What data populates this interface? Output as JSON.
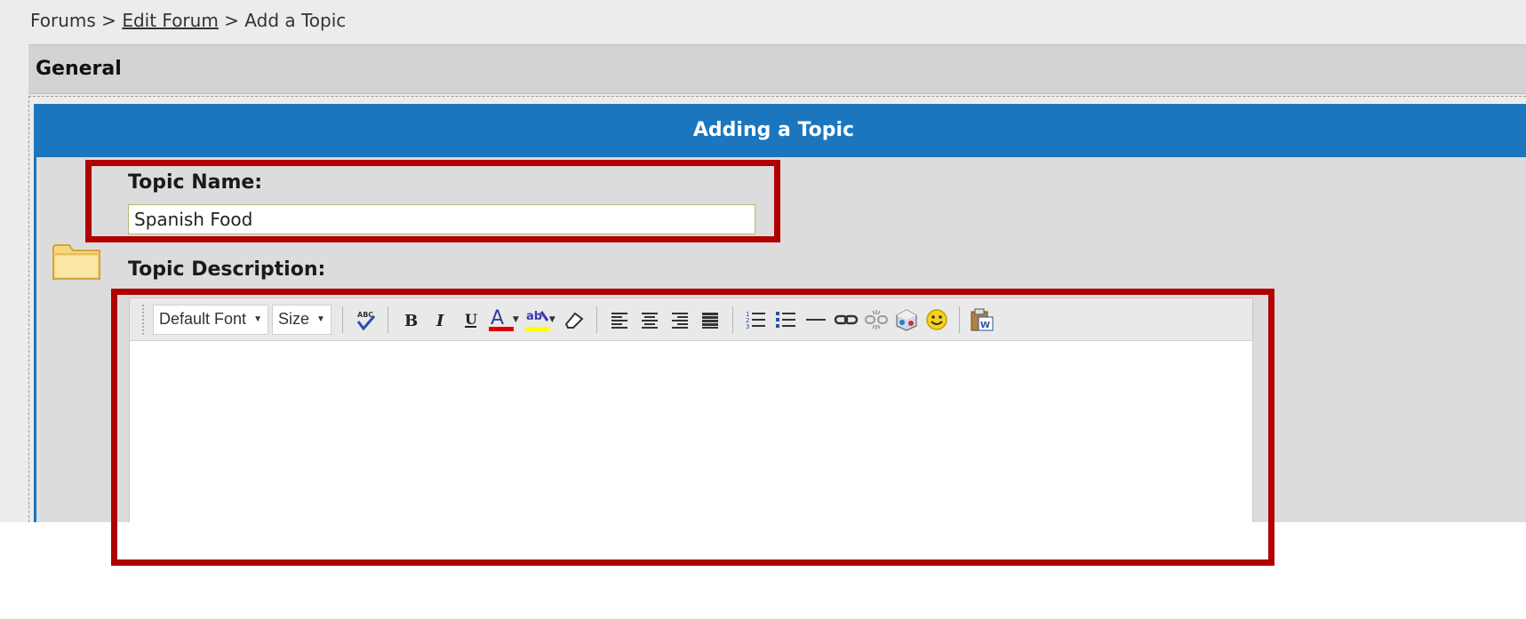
{
  "breadcrumb": {
    "item1": "Forums",
    "sep1": " > ",
    "item2": "Edit Forum",
    "sep2": " > ",
    "item3": "Add a Topic"
  },
  "section": {
    "title": "General"
  },
  "form": {
    "title": "Adding a Topic",
    "topic_name_label": "Topic Name:",
    "topic_name_value": "Spanish Food",
    "topic_description_label": "Topic Description:",
    "description_value": ""
  },
  "toolbar": {
    "font_dropdown": "Default Font",
    "size_dropdown": "Size",
    "buttons": [
      "spellcheck-icon",
      "bold-icon",
      "italic-icon",
      "underline-icon",
      "font-color-icon",
      "highlight-color-icon",
      "eraser-icon",
      "align-left-icon",
      "align-center-icon",
      "align-right-icon",
      "align-justify-icon",
      "ordered-list-icon",
      "unordered-list-icon",
      "horizontal-rule-icon",
      "link-icon",
      "unlink-icon",
      "insert-media-icon",
      "emoticon-icon",
      "paste-from-word-icon"
    ]
  },
  "colors": {
    "header_blue": "#1b76bd",
    "highlight_red": "#b00000",
    "panel_gray": "#dcdcdc",
    "section_gray": "#d3d3d3"
  }
}
